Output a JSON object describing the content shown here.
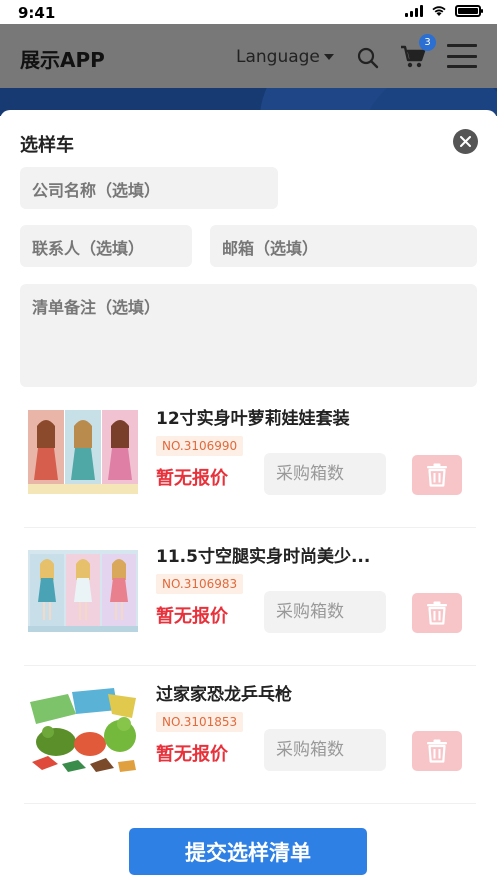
{
  "status_bar": {
    "time": "9:41"
  },
  "header": {
    "app_name": "展示APP",
    "language_label": "Language",
    "cart_count": "3"
  },
  "sheet": {
    "title": "选样车",
    "company_placeholder": "公司名称（选填）",
    "contact_placeholder": "联系人（选填）",
    "email_placeholder": "邮箱（选填）",
    "notes_placeholder": "清单备注（选填）",
    "items": [
      {
        "name": "12寸实身叶萝莉娃娃套装",
        "code": "NO.3106990",
        "price": "暂无报价",
        "qty_placeholder": "采购箱数"
      },
      {
        "name": "11.5寸空腿实身时尚美少...",
        "code": "NO.3106983",
        "price": "暂无报价",
        "qty_placeholder": "采购箱数"
      },
      {
        "name": "过家家恐龙乒乓枪",
        "code": "NO.3101853",
        "price": "暂无报价",
        "qty_placeholder": "采购箱数"
      }
    ],
    "submit_label": "提交选样清单"
  },
  "colors": {
    "accent": "#2f80e4",
    "price_red": "#e8313a",
    "delete_bg": "#f7c5c8",
    "header_bg": "#787878"
  }
}
